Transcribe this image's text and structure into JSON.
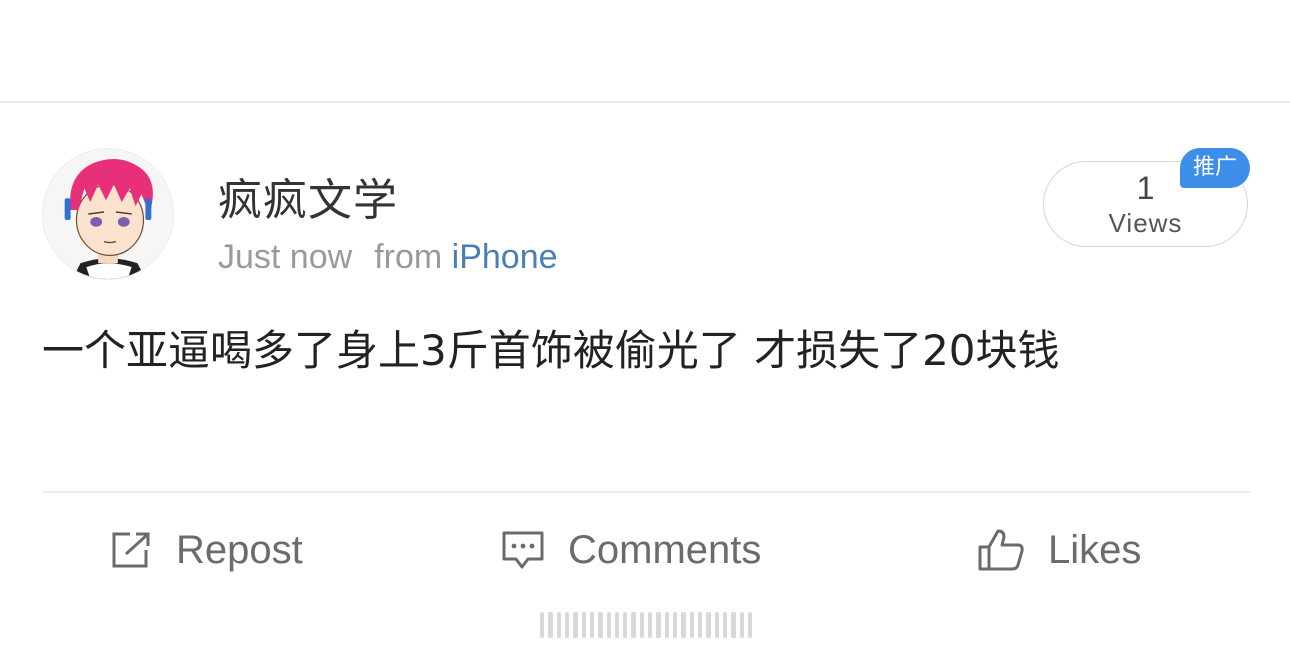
{
  "post": {
    "author": "疯疯文学",
    "timestamp": "Just now",
    "source_prefix": "from",
    "source_device": "iPhone",
    "text": "一个亚逼喝多了身上3斤首饰被偷光了 才损失了20块钱"
  },
  "stats": {
    "views_count": "1",
    "views_label": "Views",
    "promo_badge": "推广"
  },
  "actions": {
    "repost_label": "Repost",
    "comments_label": "Comments",
    "likes_label": "Likes"
  },
  "colors": {
    "link_blue": "#4a7fb6",
    "badge_blue": "#3d8ee8",
    "avatar_hair": "#e8307a"
  },
  "icons": {
    "repost": "repost-icon",
    "comments": "comment-icon",
    "likes": "thumbs-up-icon"
  }
}
